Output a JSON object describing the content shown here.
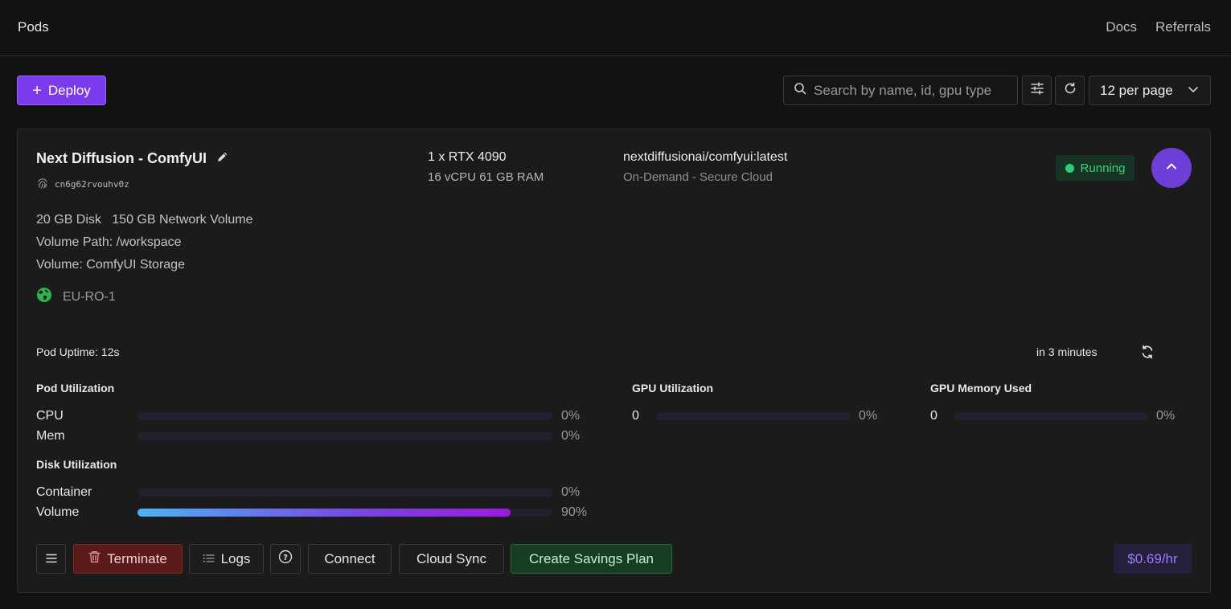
{
  "header": {
    "title": "Pods",
    "nav": [
      "Docs",
      "Referrals"
    ]
  },
  "toolbar": {
    "deploy_label": "Deploy",
    "search_placeholder": "Search by name, id, gpu type",
    "per_page": "12 per page"
  },
  "pod": {
    "name": "Next Diffusion - ComfyUI",
    "id": "cn6g62rvouhv0z",
    "gpu": "1 x RTX 4090",
    "specs": "16 vCPU 61 GB RAM",
    "image": "nextdiffusionai/comfyui:latest",
    "cloud": "On-Demand - Secure Cloud",
    "status": "Running",
    "disk": "20 GB Disk",
    "network_volume": "150 GB Network Volume",
    "volume_path": "Volume Path: /workspace",
    "volume_name": "Volume: ComfyUI Storage",
    "region": "EU-RO-1",
    "uptime": "Pod Uptime: 12s",
    "next_update": "in 3 minutes",
    "price": "$0.69/hr"
  },
  "metrics": {
    "pod_util_title": "Pod Utilization",
    "cpu": {
      "label": "CPU",
      "value": 0,
      "text": "0%"
    },
    "mem": {
      "label": "Mem",
      "value": 0,
      "text": "0%"
    },
    "disk_util_title": "Disk Utilization",
    "container": {
      "label": "Container",
      "value": 0,
      "text": "0%"
    },
    "volume": {
      "label": "Volume",
      "value": 90,
      "text": "90%"
    },
    "gpu_util": {
      "title": "GPU Utilization",
      "count": "0",
      "value": 0,
      "text": "0%"
    },
    "gpu_mem": {
      "title": "GPU Memory Used",
      "count": "0",
      "value": 0,
      "text": "0%"
    }
  },
  "actions": {
    "terminate": "Terminate",
    "logs": "Logs",
    "connect": "Connect",
    "cloud_sync": "Cloud Sync",
    "savings_plan": "Create Savings Plan"
  },
  "colors": {
    "accent": "#7c3aed",
    "running": "#2ecc71",
    "terminate": "#5a1a1a",
    "savings": "#173d22"
  }
}
